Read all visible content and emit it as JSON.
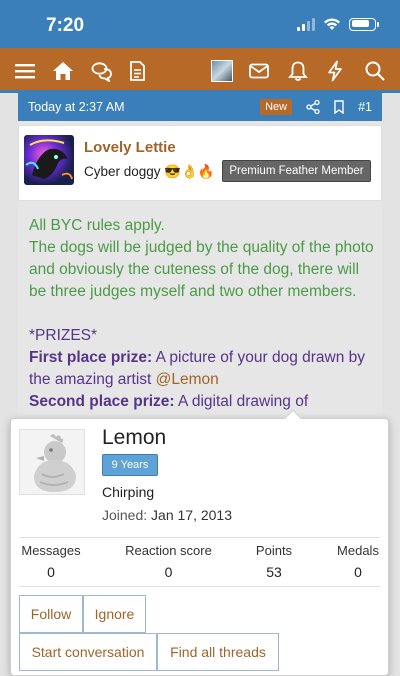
{
  "status_bar": {
    "time": "7:20"
  },
  "navbar": {
    "icons": [
      "menu-icon",
      "home-icon",
      "chat-icon",
      "document-icon",
      "avatar",
      "mail-icon",
      "bell-icon",
      "lightning-icon",
      "search-icon"
    ]
  },
  "post": {
    "date": "Today at 2:37 AM",
    "new_label": "New",
    "post_number": "#1",
    "author": {
      "name": "Lovely Lettie",
      "title": "Cyber doggy 😎👌🔥",
      "badge": "Premium Feather Member"
    },
    "body": {
      "line1": "All BYC rules apply.",
      "line2": "The dogs will be judged by the quality of the photo and obviously the cuteness of the dog, there will be three judges myself and two other members.",
      "prizes_heading": "*PRIZES*",
      "first_label": "First place prize:",
      "first_text": " A picture of your dog drawn by the amazing artist ",
      "first_mention": "@Lemon",
      "second_label": "Second place prize:",
      "second_text": " A digital drawing of"
    }
  },
  "member_popup": {
    "name": "Lemon",
    "years_badge": "9 Years",
    "status": "Chirping",
    "joined_label": "Joined:",
    "joined_date": "Jan 17, 2013",
    "stats": [
      {
        "label": "Messages",
        "value": "0"
      },
      {
        "label": "Reaction score",
        "value": "0"
      },
      {
        "label": "Points",
        "value": "53"
      },
      {
        "label": "Medals",
        "value": "0"
      }
    ],
    "buttons": {
      "follow": "Follow",
      "ignore": "Ignore",
      "start_conversation": "Start conversation",
      "find_threads": "Find all threads"
    }
  },
  "colors": {
    "header_blue": "#3a7fb9",
    "nav_brown": "#b76a27",
    "body_green": "#4c9a48",
    "prize_purple": "#56348a",
    "link_brown": "#a0642a"
  }
}
